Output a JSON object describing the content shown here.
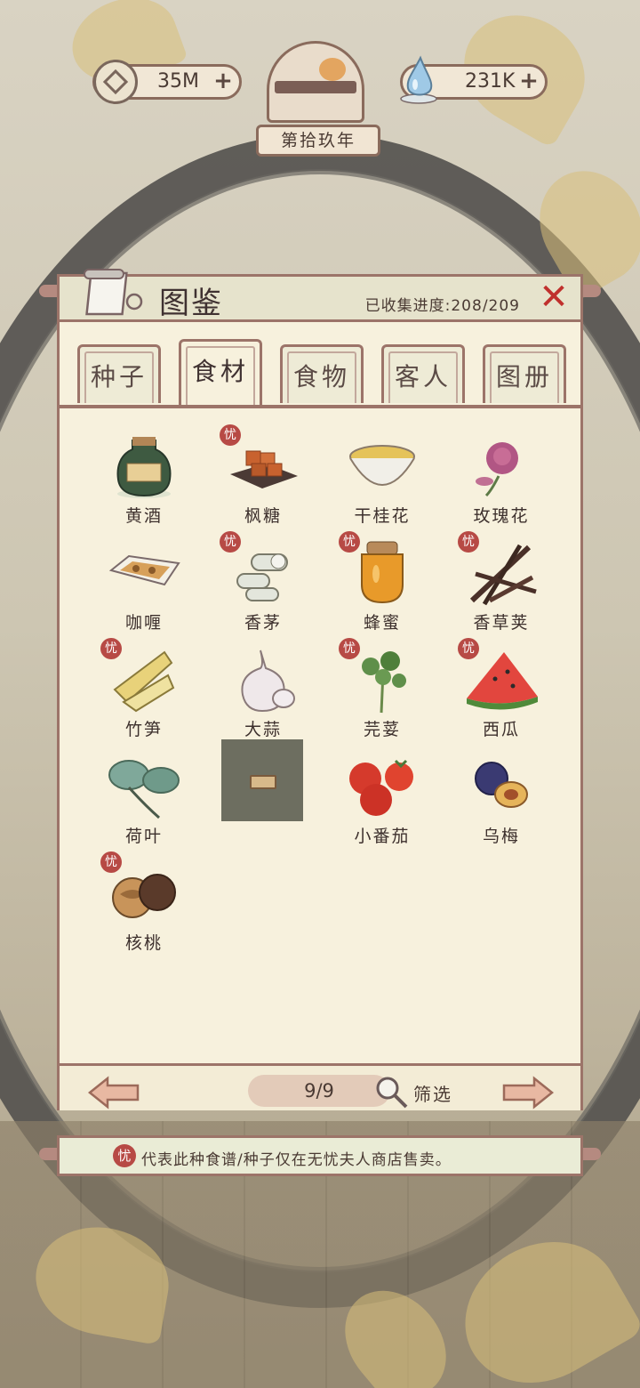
{
  "currency": {
    "coins": "35M",
    "jade": "231K"
  },
  "year_label": "第拾玖年",
  "panel": {
    "title": "图鉴",
    "progress_label": "已收集进度:208/209"
  },
  "tabs": [
    {
      "label": "种子",
      "active": false
    },
    {
      "label": "食材",
      "active": true
    },
    {
      "label": "食物",
      "active": false
    },
    {
      "label": "客人",
      "active": false
    },
    {
      "label": "图册",
      "active": false
    }
  ],
  "items": [
    {
      "name": "黄酒",
      "exclusive": false
    },
    {
      "name": "枫糖",
      "exclusive": true
    },
    {
      "name": "干桂花",
      "exclusive": false
    },
    {
      "name": "玫瑰花",
      "exclusive": false
    },
    {
      "name": "咖喱",
      "exclusive": false
    },
    {
      "name": "香茅",
      "exclusive": true
    },
    {
      "name": "蜂蜜",
      "exclusive": true
    },
    {
      "name": "香草荚",
      "exclusive": true
    },
    {
      "name": "竹笋",
      "exclusive": true
    },
    {
      "name": "大蒜",
      "exclusive": false
    },
    {
      "name": "芫荽",
      "exclusive": true
    },
    {
      "name": "西瓜",
      "exclusive": true
    },
    {
      "name": "荷叶",
      "exclusive": false
    },
    {
      "name": "",
      "locked": true
    },
    {
      "name": "小番茄",
      "exclusive": false
    },
    {
      "name": "乌梅",
      "exclusive": false
    },
    {
      "name": "核桃",
      "exclusive": true
    }
  ],
  "badge_char": "忧",
  "pagination": {
    "page": "9/9",
    "filter_label": "筛选"
  },
  "note": {
    "badge_char": "忧",
    "text": "代表此种食谱/种子仅在无忧夫人商店售卖。"
  },
  "colors": {
    "badge": "#b74a45",
    "close": "#c0302d",
    "panel": "#f7f1dd",
    "border": "#9c7469"
  }
}
